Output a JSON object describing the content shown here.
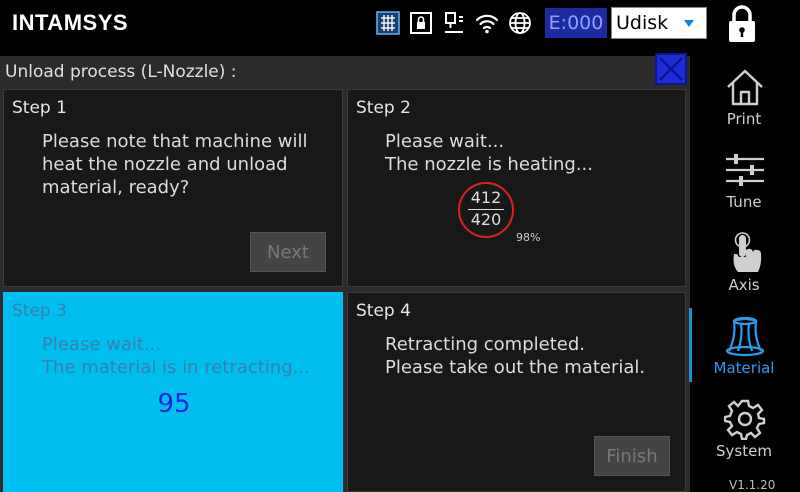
{
  "header": {
    "brand": "INTAMSYS",
    "icons": [
      "grid-icon",
      "card-lock-icon",
      "ethernet-icon",
      "wifi-icon",
      "globe-icon"
    ],
    "counter": "E:000",
    "storage": {
      "selected": "Udisk"
    },
    "lock_icon": "padlock-icon"
  },
  "panel": {
    "title": "Unload process (L-Nozzle) :",
    "steps": [
      {
        "label": "Step 1",
        "line1": "Please note that machine will",
        "line2": "heat the nozzle and unload",
        "line3": "material, ready?",
        "button": "Next"
      },
      {
        "label": "Step 2",
        "line1": "Please wait...",
        "line2": "The nozzle is heating...",
        "temp_current": "412",
        "temp_target": "420",
        "percent": "98%"
      },
      {
        "label": "Step 3",
        "line1": "Please wait...",
        "line2": "The material is in retracting...",
        "progress": "95"
      },
      {
        "label": "Step 4",
        "line1": "Retracting completed.",
        "line2": "Please take out the material.",
        "button": "Finish"
      }
    ]
  },
  "nav": {
    "items": [
      {
        "label": "Print",
        "icon": "home-icon"
      },
      {
        "label": "Tune",
        "icon": "sliders-icon"
      },
      {
        "label": "Axis",
        "icon": "hand-pointer-icon"
      },
      {
        "label": "Material",
        "icon": "spool-icon",
        "active": true
      },
      {
        "label": "System",
        "icon": "gear-icon"
      }
    ],
    "version": "V1.1.20"
  },
  "colors": {
    "accent_blue": "#1d2bd8",
    "active_step": "#00bff0",
    "nav_active": "#2a9cf0",
    "gauge_ring": "#e02020"
  }
}
